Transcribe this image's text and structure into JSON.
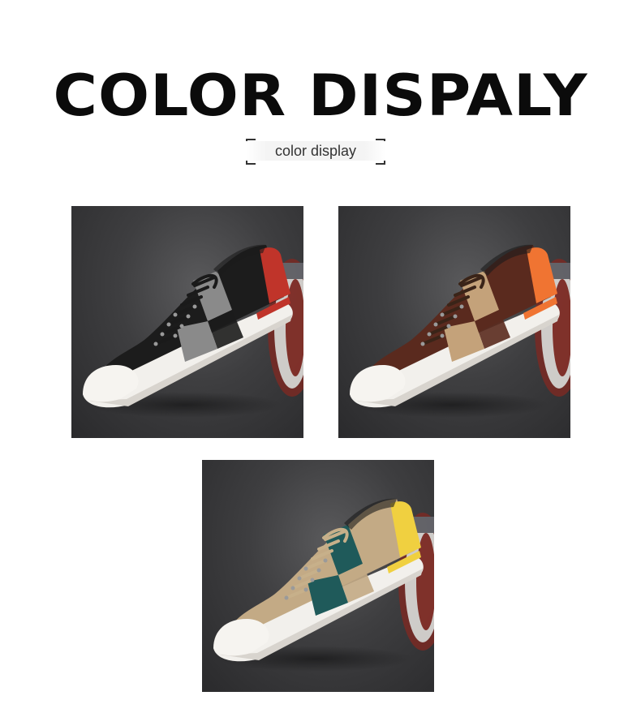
{
  "header": {
    "title": "COLOR DISPALY",
    "subtitle": "color display"
  },
  "products": [
    {
      "colorway": "black-grey-red",
      "colors": {
        "main": "#1c1c1c",
        "panel": "#8a8a8a",
        "heel": "#c0342a",
        "lace": "#1a1a1a"
      }
    },
    {
      "colorway": "brown-beige-orange",
      "colors": {
        "main": "#5a2a1e",
        "panel": "#c4a27a",
        "heel": "#f07432",
        "lace": "#3a2418"
      }
    },
    {
      "colorway": "khaki-teal-yellow",
      "colors": {
        "main": "#c3aa85",
        "panel": "#1f5a5a",
        "heel": "#f0d040",
        "lace": "#c7b08a"
      }
    }
  ]
}
